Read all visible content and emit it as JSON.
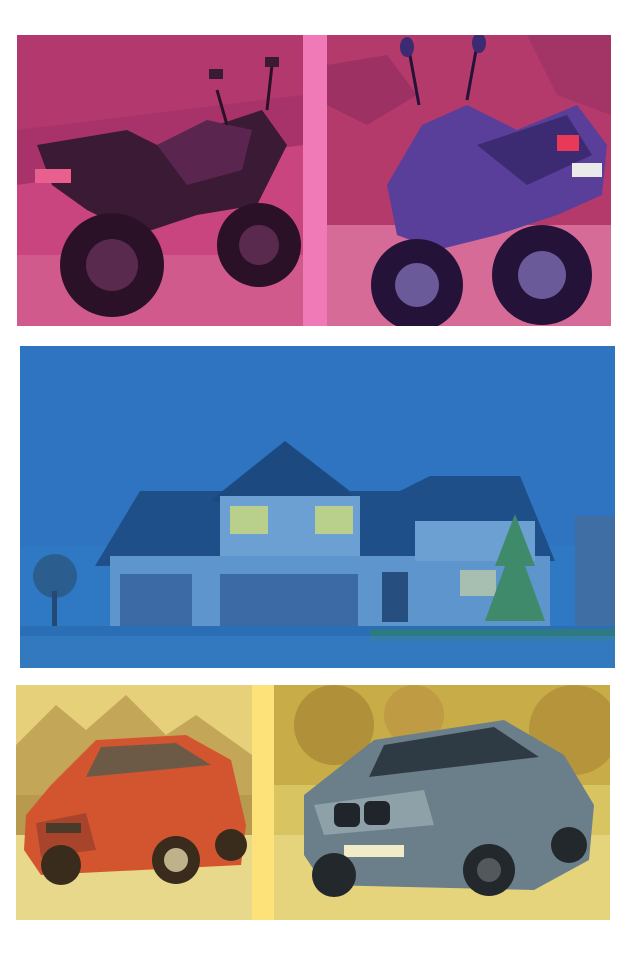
{
  "collage": {
    "rows": [
      {
        "theme": "motorcycles",
        "tint": "#e0508f",
        "images": [
          {
            "subject": "sport-motorcycle-rear-view"
          },
          {
            "subject": "blue-commuter-motorcycle-with-plate"
          }
        ]
      },
      {
        "theme": "house",
        "tint": "#2a78c8",
        "images": [
          {
            "subject": "two-story-house-with-two-garages"
          }
        ]
      },
      {
        "theme": "cars",
        "tint": "#e8c840",
        "images": [
          {
            "subject": "red-mazda-suv"
          },
          {
            "subject": "blue-bmw-sedan"
          }
        ]
      }
    ]
  }
}
